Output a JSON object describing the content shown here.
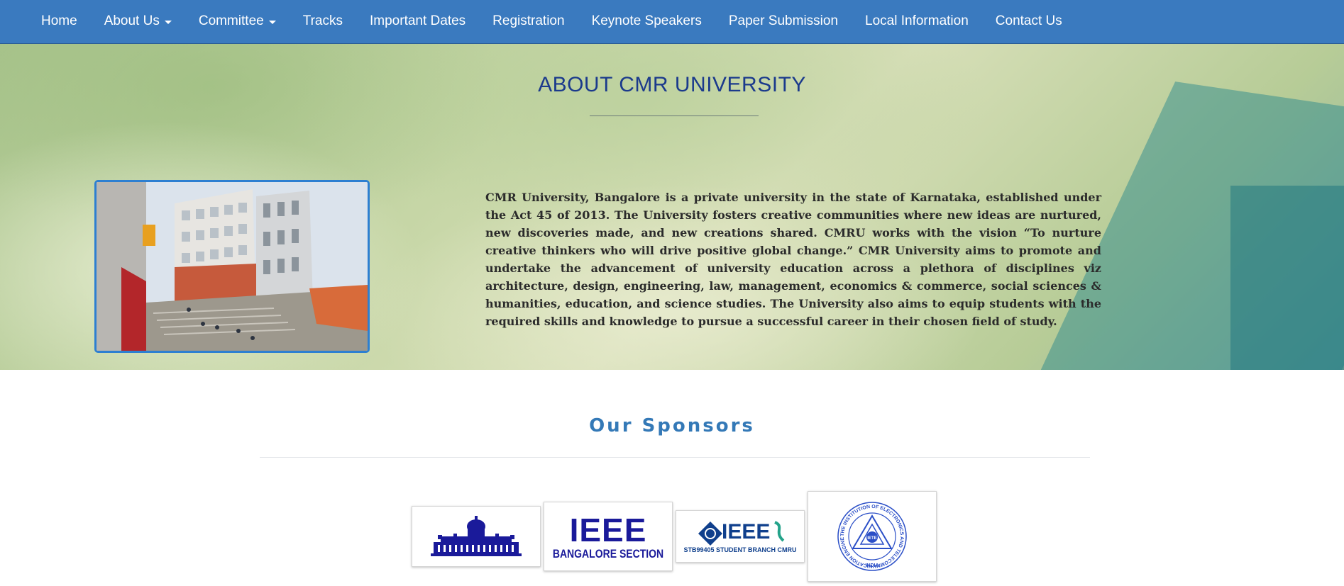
{
  "nav": {
    "items": [
      {
        "label": "Home",
        "dropdown": false
      },
      {
        "label": "About Us",
        "dropdown": true
      },
      {
        "label": "Committee",
        "dropdown": true
      },
      {
        "label": "Tracks",
        "dropdown": false
      },
      {
        "label": "Important Dates",
        "dropdown": false
      },
      {
        "label": "Registration",
        "dropdown": false
      },
      {
        "label": "Keynote Speakers",
        "dropdown": false
      },
      {
        "label": "Paper Submission",
        "dropdown": false
      },
      {
        "label": "Local Information",
        "dropdown": false
      },
      {
        "label": "Contact Us",
        "dropdown": false
      }
    ]
  },
  "about": {
    "title": "ABOUT CMR UNIVERSITY",
    "text": "CMR University, Bangalore is a private university in the state of Karnataka, established under the Act 45 of 2013. The University fosters creative communities where new ideas are nurtured, new discoveries made, and new creations shared. CMRU works with the vision “To nurture creative thinkers who will drive positive global change.” CMR University aims to promote and undertake the advancement of university education across a plethora of disciplines viz architecture, design, engineering, law, management, economics & commerce, social sciences & humanities, education, and science studies. The University also aims to equip students with the required skills and knowledge to pursue a successful career in their chosen field of study."
  },
  "sponsors": {
    "title": "Our Sponsors",
    "logos": {
      "ieee_main": "IEEE",
      "ieee_section": "BANGALORE SECTION",
      "ieee_branch": "IEEE",
      "branch_code": "STB99405",
      "branch_text": "STUDENT BRANCH",
      "branch_uni": "CMRU",
      "iete_mark": "IETE",
      "iete_ring": "THE INSTITUTION OF ELECTRONICS AND TELECOMMUNICATION ENGINEERS",
      "iete_country": "INDIA"
    }
  },
  "colors": {
    "navbar": "#3a7abf",
    "about_title": "#1b3a8c",
    "sponsor_title": "#3479b7",
    "logo_navy": "#1a1a9a"
  }
}
